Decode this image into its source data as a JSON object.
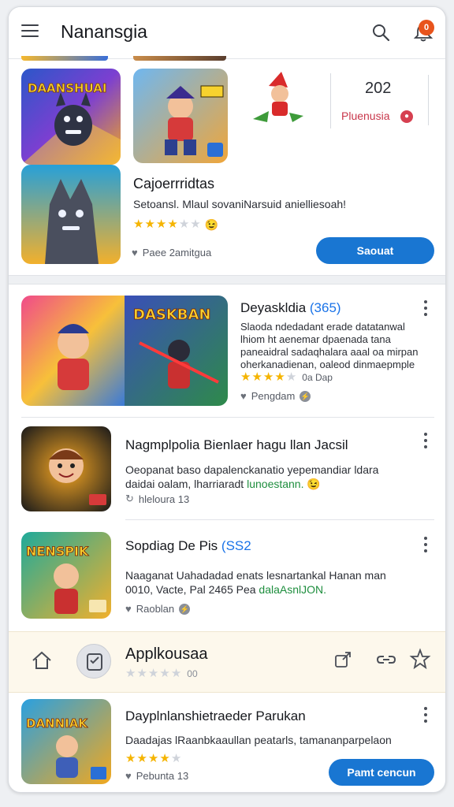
{
  "header": {
    "title": "Nanansgia",
    "notification_count": "0"
  },
  "featured": {
    "tile1_caption": "DAANSHUAI",
    "title": "Cajoerrridtas",
    "description": "Setoansl. Mlaul sovaniNarsuid anielliesoah!",
    "rating_emoji": "😉",
    "meta": "Paee 2amitgua",
    "button_label": "Saouat",
    "mini_version": "202",
    "mini_publisher": "Pluenusia"
  },
  "items": [
    {
      "title": "Deyaskldia",
      "title_accent": "(365)",
      "desc_lines": [
        "Slaoda ndedadant erade datatanwal",
        "lhiom ht aenemar dpaenada tana",
        "paneaidral sadaqhalara aaal oa mirpan",
        "oherkanadienan, oaleod dinmaepmple"
      ],
      "extra": "0a Dap",
      "meta": "Pengdam",
      "tile_caption": "DASKBAN"
    },
    {
      "title": "Nagmplpolia Bienlaer hagu llan Jacsil",
      "desc_line1": "Oeopanat baso dapalenckanatio yepemandiar ldara",
      "desc_line2_plain": "daidai oalam, lharriaradt ",
      "desc_line2_link": "lunoestann.",
      "emoji": "😉",
      "meta": "hleloura 13"
    },
    {
      "title": "Sopdiag De Pis",
      "title_accent": "(SS2",
      "desc_line1": "Naaganat Uahadadad enats lesnartankal Hanan man",
      "desc_line2_plain": "0010, Vacte, Pal 2465 Pea ",
      "desc_line2_link": "dalaAsnlJON.",
      "meta": "Raoblan",
      "tile_caption": "NENSPIK"
    }
  ],
  "bottom_bar": {
    "label": "Applkousaa",
    "rating_text": "00"
  },
  "last_item": {
    "title": "Dayplnlanshietraeder Parukan",
    "description": "Daadajas lRaanbkaaullan peatarls, tamananparpelaon",
    "meta": "Pebunta 13",
    "button_label": "Pamt cencun",
    "tile_caption": "DANNIAK"
  },
  "colors": {
    "accent": "#1976d2",
    "star": "#f5b400",
    "badge": "#e8541c"
  }
}
